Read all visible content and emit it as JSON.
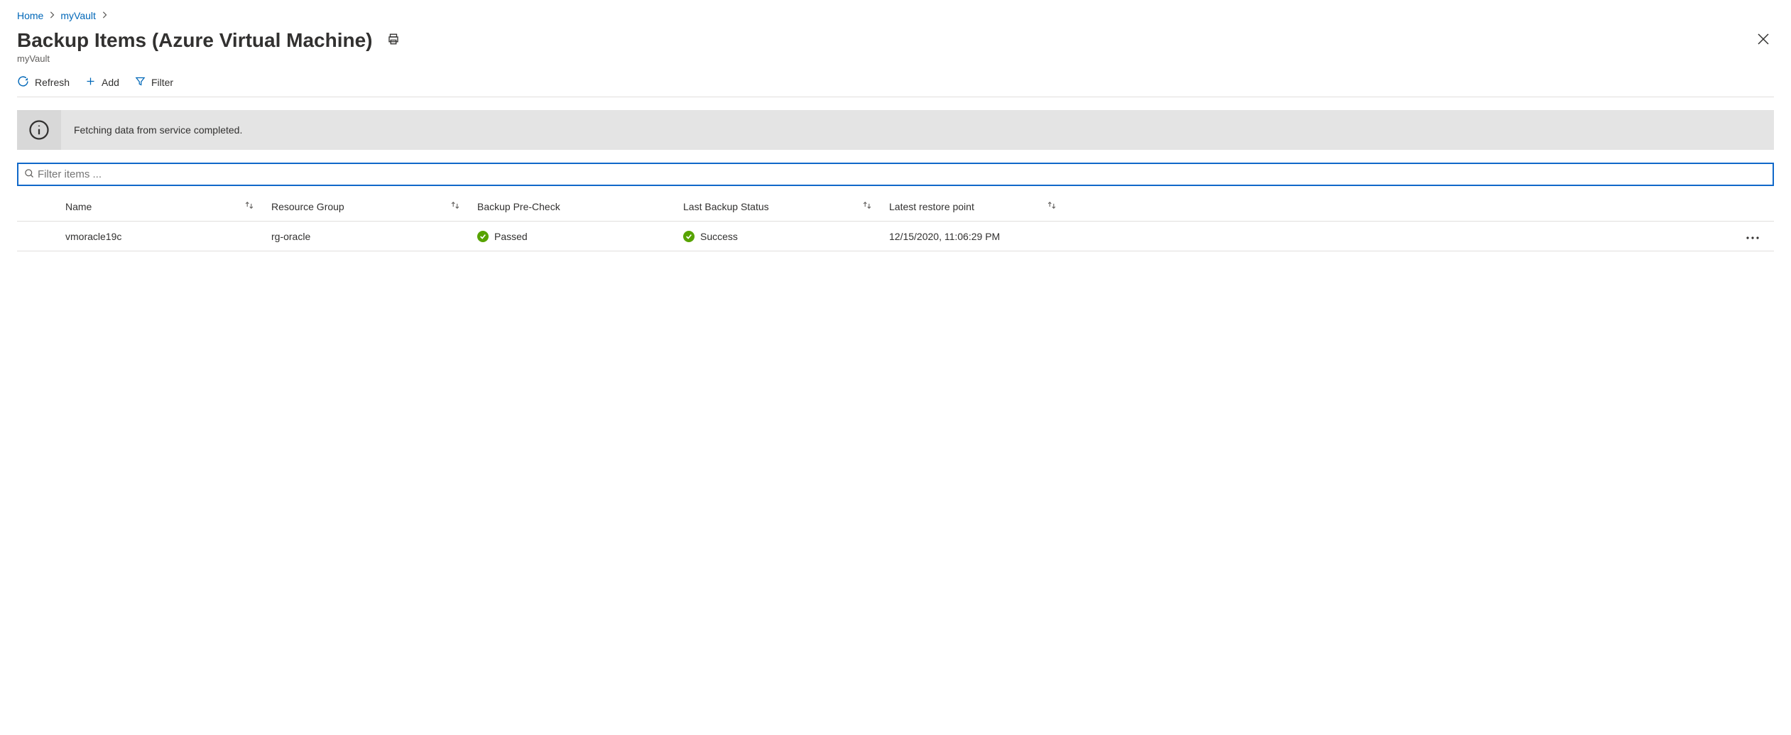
{
  "breadcrumb": {
    "home": "Home",
    "vault": "myVault"
  },
  "header": {
    "title": "Backup Items (Azure Virtual Machine)",
    "subtitle": "myVault"
  },
  "toolbar": {
    "refresh": "Refresh",
    "add": "Add",
    "filter": "Filter"
  },
  "notice": {
    "message": "Fetching data from service completed."
  },
  "search": {
    "placeholder": "Filter items ...",
    "value": ""
  },
  "columns": {
    "name": "Name",
    "rg": "Resource Group",
    "precheck": "Backup Pre-Check",
    "status": "Last Backup Status",
    "restore": "Latest restore point"
  },
  "rows": [
    {
      "name": "vmoracle19c",
      "rg": "rg-oracle",
      "precheck": "Passed",
      "status": "Success",
      "restore": "12/15/2020, 11:06:29 PM"
    }
  ]
}
